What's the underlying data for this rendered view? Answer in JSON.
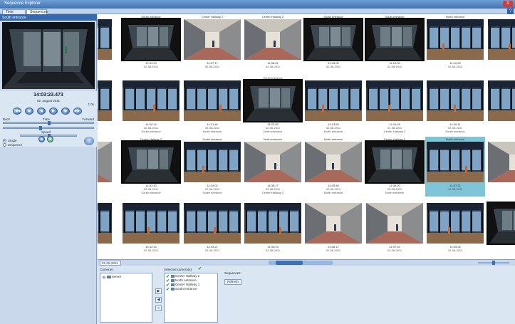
{
  "window": {
    "title": "Sequence Explorer",
    "close_label": "X"
  },
  "tabs": [
    {
      "label": "Time Browser"
    },
    {
      "label": "Sequences"
    }
  ],
  "help_label": "?",
  "preview": {
    "camera_label": "South entrance",
    "timecode": "14:03:23.473",
    "date": "02. august 2011",
    "speed": "1.0x",
    "buttons": [
      "|◀◀",
      "◀|",
      "◀",
      "▶",
      "|▶",
      "▶▶|"
    ],
    "slider_labels": {
      "left": "Back",
      "right": "Forward",
      "mid_top": "Time",
      "mid_bottom": "Speed"
    },
    "option_single": "Single",
    "option_sequence": "Sequence"
  },
  "grid": {
    "rows": [
      {
        "cameras": [
          "",
          "South entrance",
          "Center Hallway 2",
          "Center Hallway 2",
          "South entrance",
          "South entrance",
          "North entrance",
          ""
        ],
        "times": [
          "",
          "14:03:23",
          "14:07:17",
          "14:08:02",
          "14:09:00",
          "14:10:00",
          "14:12:25",
          ""
        ],
        "dates": [
          "",
          "02-08-2011",
          "02-08-2011",
          "02-08-2011",
          "02-08-2011",
          "02-08-2011",
          "02-08-2011",
          ""
        ],
        "subs": [
          "",
          "",
          "",
          "",
          "",
          "",
          "",
          ""
        ]
      },
      {
        "cameras": [
          "",
          "",
          "",
          "South entrance",
          "",
          "",
          "",
          ""
        ],
        "times": [
          "",
          "14:20:14",
          "14:21:46",
          "14:23:05",
          "14:23:55",
          "14:24:48",
          "14:26:41",
          ""
        ],
        "dates": [
          "",
          "02-08-2011",
          "02-08-2011",
          "02-08-2011",
          "02-08-2011",
          "02-08-2011",
          "02-08-2011",
          ""
        ],
        "subs": [
          "",
          "South entrance",
          "North entrance",
          "North entrance",
          "North entrance",
          "Center Hallway 2",
          "South entrance",
          ""
        ]
      },
      {
        "cameras": [
          "",
          "Center Hallway 2",
          "South entrance",
          "North entrance",
          "North entrance",
          "Center Hallway 2",
          "North entrance",
          ""
        ],
        "times": [
          "",
          "14:33:10",
          "14:34:02",
          "14:35:17",
          "14:35:48",
          "14:36:20",
          "14:37:21",
          ""
        ],
        "dates": [
          "",
          "02-08-2011",
          "02-08-2011",
          "02-08-2011",
          "02-08-2011",
          "02-08-2011",
          "02-08-2011",
          ""
        ],
        "subs": [
          "",
          "South entrance",
          "South entrance",
          "Center Hallway 2",
          "North entrance",
          "North entrance",
          "",
          ""
        ]
      },
      {
        "cameras": [
          "",
          "",
          "",
          "",
          "",
          "",
          "",
          ""
        ],
        "times": [
          "",
          "14:42:14",
          "14:43:21",
          "14:45:03",
          "14:46:17",
          "14:47:44",
          "14:49:06",
          ""
        ],
        "dates": [
          "",
          "02-08-2011",
          "02-08-2011",
          "02-08-2011",
          "02-08-2011",
          "02-08-2011",
          "02-08-2011",
          ""
        ],
        "subs": [
          "",
          "",
          "",
          "",
          "",
          "",
          "",
          ""
        ]
      }
    ]
  },
  "strip": {
    "date": "02-08-2011 ▾"
  },
  "bottom": {
    "cameras_label": "Cameras:",
    "tree_root": "Server",
    "selected_label": "Selected camera(s):",
    "selected": [
      "Center Hallway 2",
      "North entrance",
      "Center Hallway 1",
      "South entrance"
    ],
    "sequences_label": "Sequences:",
    "refresh_label": "Refresh",
    "btn_add": "▶",
    "btn_remove": "◀",
    "btn_clear": "«"
  },
  "colors": {
    "accent": "#3769ad",
    "selected_cell": "#7dc4d6"
  }
}
